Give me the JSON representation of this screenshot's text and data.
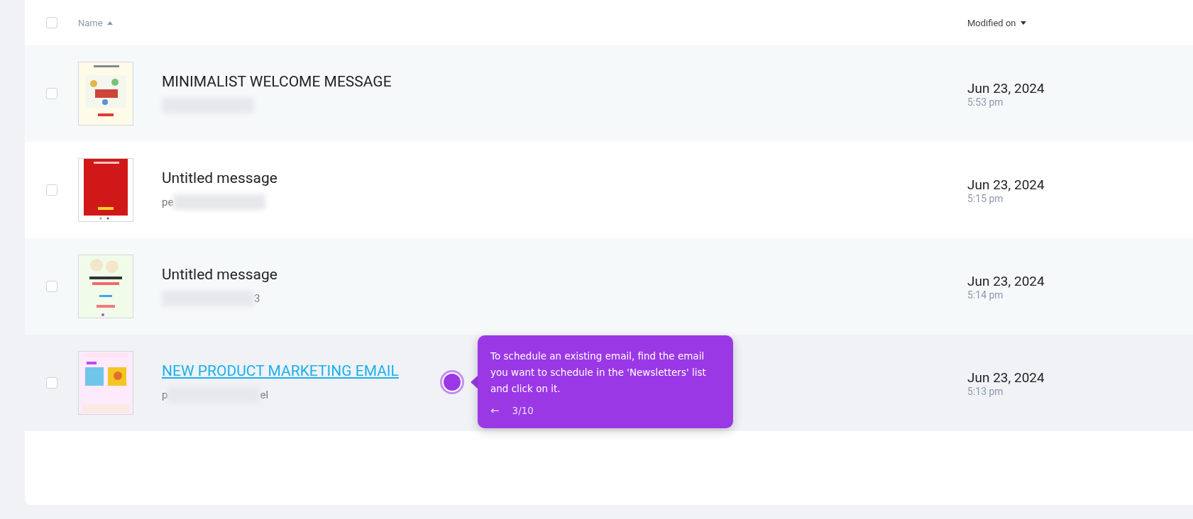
{
  "table": {
    "select_all": {
      "checked": false
    },
    "columns": [
      {
        "label": "Name",
        "sorted_ascending": true
      },
      {
        "label": "Modified on",
        "sorted_ascending": false
      }
    ],
    "rows": [
      {
        "checked": false,
        "hovered": false,
        "title": "MINIMALIST WELCOME MESSAGE",
        "subtitle_before": "",
        "subtitle_after": "",
        "date": "Jun 23, 2024",
        "time": "5:53 pm"
      },
      {
        "checked": false,
        "hovered": false,
        "title": "Untitled message",
        "subtitle_before": "pe",
        "subtitle_after": "",
        "date": "Jun 23, 2024",
        "time": "5:15 pm"
      },
      {
        "checked": false,
        "hovered": false,
        "title": "Untitled message",
        "subtitle_before": "",
        "subtitle_after": "3",
        "date": "Jun 23, 2024",
        "time": "5:14 pm"
      },
      {
        "checked": false,
        "hovered": true,
        "title": "NEW PRODUCT MARKETING EMAIL",
        "subtitle_before": "p",
        "subtitle_after": "el",
        "date": "Jun 23, 2024",
        "time": "5:13 pm"
      }
    ]
  },
  "tour_tooltip": {
    "text": "To schedule an existing email, find the email you want to schedule in the 'Newsletters' list and click on it.",
    "back": "←",
    "step": "3/10"
  }
}
